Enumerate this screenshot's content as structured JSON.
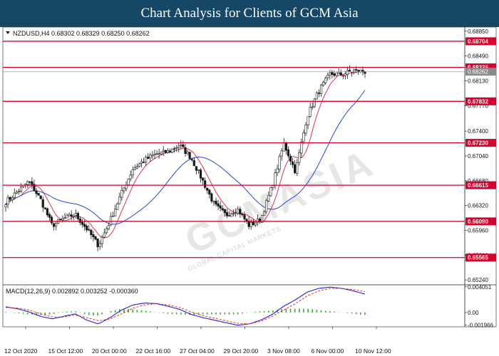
{
  "header": {
    "title": "Chart Analysis for Clients of GCM Asia"
  },
  "watermark": {
    "text": "GCMASIA",
    "subtext": "GLOBAL CAPITAL MARKETS"
  },
  "colors": {
    "level_line": "#d6002a",
    "level_label_bg": "#d6002a",
    "price_tag_bg": "#8a8a8a",
    "ma_fast": "#e2324a",
    "ma_slow": "#2546d6",
    "macd_line": "#2020e0",
    "signal_line": "#e03020",
    "histogram": "#3aaa35",
    "candle": "#1a1a1a"
  },
  "chart_data": [
    {
      "type": "candlestick",
      "panel": "price",
      "symbol_info": {
        "symbol": "NZDUSD,H4",
        "open": "0.68302",
        "high": "0.68329",
        "low": "0.68250",
        "close": "0.68262"
      },
      "y_axis_labels": [
        "0.68850",
        "0.68490",
        "0.68130",
        "0.67770",
        "0.67400",
        "0.67040",
        "0.66680",
        "0.66320",
        "0.65960",
        "0.65600",
        "0.65240"
      ],
      "ylim": [
        0.6518,
        0.6891
      ],
      "x_axis_labels": [
        "12 Oct 2020",
        "15 Oct 12:00",
        "20 Oct 00:00",
        "22 Oct 16:00",
        "27 Oct 04:00",
        "29 Oct 20:00",
        "3 Nov 08:00",
        "6 Nov 00:00",
        "10 Nov 12:00"
      ],
      "current_price": "0.68262",
      "levels": [
        "0.68704",
        "0.68325",
        "0.67832",
        "0.67230",
        "0.66615",
        "0.66090",
        "0.65565"
      ],
      "anchors": [
        0.6637,
        0.6652,
        0.6667,
        0.6641,
        0.6603,
        0.6613,
        0.6619,
        0.6598,
        0.6574,
        0.661,
        0.665,
        0.6686,
        0.6698,
        0.6707,
        0.671,
        0.672,
        0.6701,
        0.6668,
        0.6633,
        0.6618,
        0.6627,
        0.6603,
        0.6612,
        0.6661,
        0.6722,
        0.6681,
        0.6761,
        0.6798,
        0.6823,
        0.6822,
        0.6828,
        0.6826
      ],
      "moving_averages": [
        {
          "window": 8,
          "color": "#e2324a"
        },
        {
          "window": 32,
          "color": "#2546d6"
        }
      ]
    },
    {
      "type": "macd",
      "panel": "macd",
      "title": "MACD(12,26,9) 0.002892 0.003252 -0.000360",
      "y_axis_labels": [
        "0.004051",
        "0.00",
        "-0.001966"
      ],
      "ylim": [
        -0.00225,
        0.00425
      ],
      "macd_anchors": [
        0.0009,
        0.0006,
        0.0001,
        -0.0006,
        -0.001,
        -0.0006,
        -0.0002,
        -0.0012,
        -0.0018,
        -0.0008,
        0.0004,
        0.0012,
        0.0015,
        0.0014,
        0.001,
        0.0005,
        -0.0003,
        -0.0008,
        -0.0012,
        -0.0016,
        -0.002,
        -0.0018,
        -0.0012,
        -0.0003,
        0.001,
        0.002,
        0.0032,
        0.0038,
        0.004,
        0.0038,
        0.0034,
        0.0029
      ],
      "signal_anchors": [
        0.0008,
        0.0007,
        0.0004,
        -0.0002,
        -0.0007,
        -0.0007,
        -0.0004,
        -0.0008,
        -0.0013,
        -0.001,
        -0.0002,
        0.0007,
        0.0012,
        0.0014,
        0.0012,
        0.0008,
        0.0001,
        -0.0005,
        -0.0009,
        -0.0013,
        -0.0017,
        -0.0018,
        -0.0014,
        -0.0006,
        0.0004,
        0.0014,
        0.0026,
        0.0034,
        0.0038,
        0.0038,
        0.0036,
        0.0033
      ]
    }
  ]
}
